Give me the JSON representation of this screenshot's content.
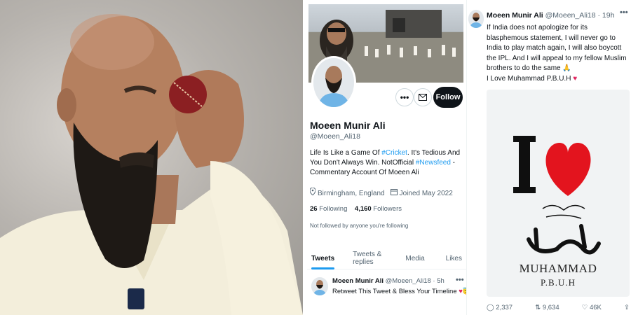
{
  "profile": {
    "display_name": "Moeen Munir Ali",
    "handle": "@Moeen_Ali18",
    "bio_1": "Life Is Like a Game Of ",
    "bio_tag_1": "#Cricket",
    "bio_2": ". It's Tedious And You Don't Always Win. NotOfficial ",
    "bio_tag_2": "#Newsfeed",
    "bio_3": " -Commentary Account Of Moeen Ali",
    "location": "Birmingham, England",
    "joined": "Joined May 2022",
    "following_count": "26",
    "following_label": "Following",
    "followers_count": "4,160",
    "followers_label": "Followers",
    "not_followed": "Not followed by anyone you're following",
    "follow_label": "Follow",
    "more_glyph": "•••",
    "message_icon": "envelope-icon",
    "location_icon": "location-pin-icon",
    "calendar_icon": "calendar-icon"
  },
  "tabs": [
    "Tweets",
    "Tweets & replies",
    "Media",
    "Likes"
  ],
  "pinned_tweet": {
    "name": "Moeen Munir Ali",
    "handle_time": "@Moeen_Ali18 · 5h",
    "text": "Retweet This Tweet & Bless Your Timeline",
    "emoji": "♥😇"
  },
  "main_tweet": {
    "name": "Moeen Munir Ali",
    "handle_time": "@Moeen_Ali18 · 19h",
    "text": "If India does not apologize for its blasphemous statement, I will never go to India to play match again, I will also boycott the IPL.  And I will appeal to my fellow Muslim brothers to do the same 🙏",
    "text_2": "I Love Muhammad P.B.U.H",
    "heart": "♥",
    "image_line_1": "MUHAMMAD",
    "image_line_2": "P.B.U.H",
    "reply_count": "2,337",
    "retweet_count": "9,634",
    "like_count": "46K"
  },
  "colors": {
    "accent": "#1d9bf0",
    "heart": "#e0245e",
    "text": "#0f1419",
    "muted": "#536471"
  }
}
